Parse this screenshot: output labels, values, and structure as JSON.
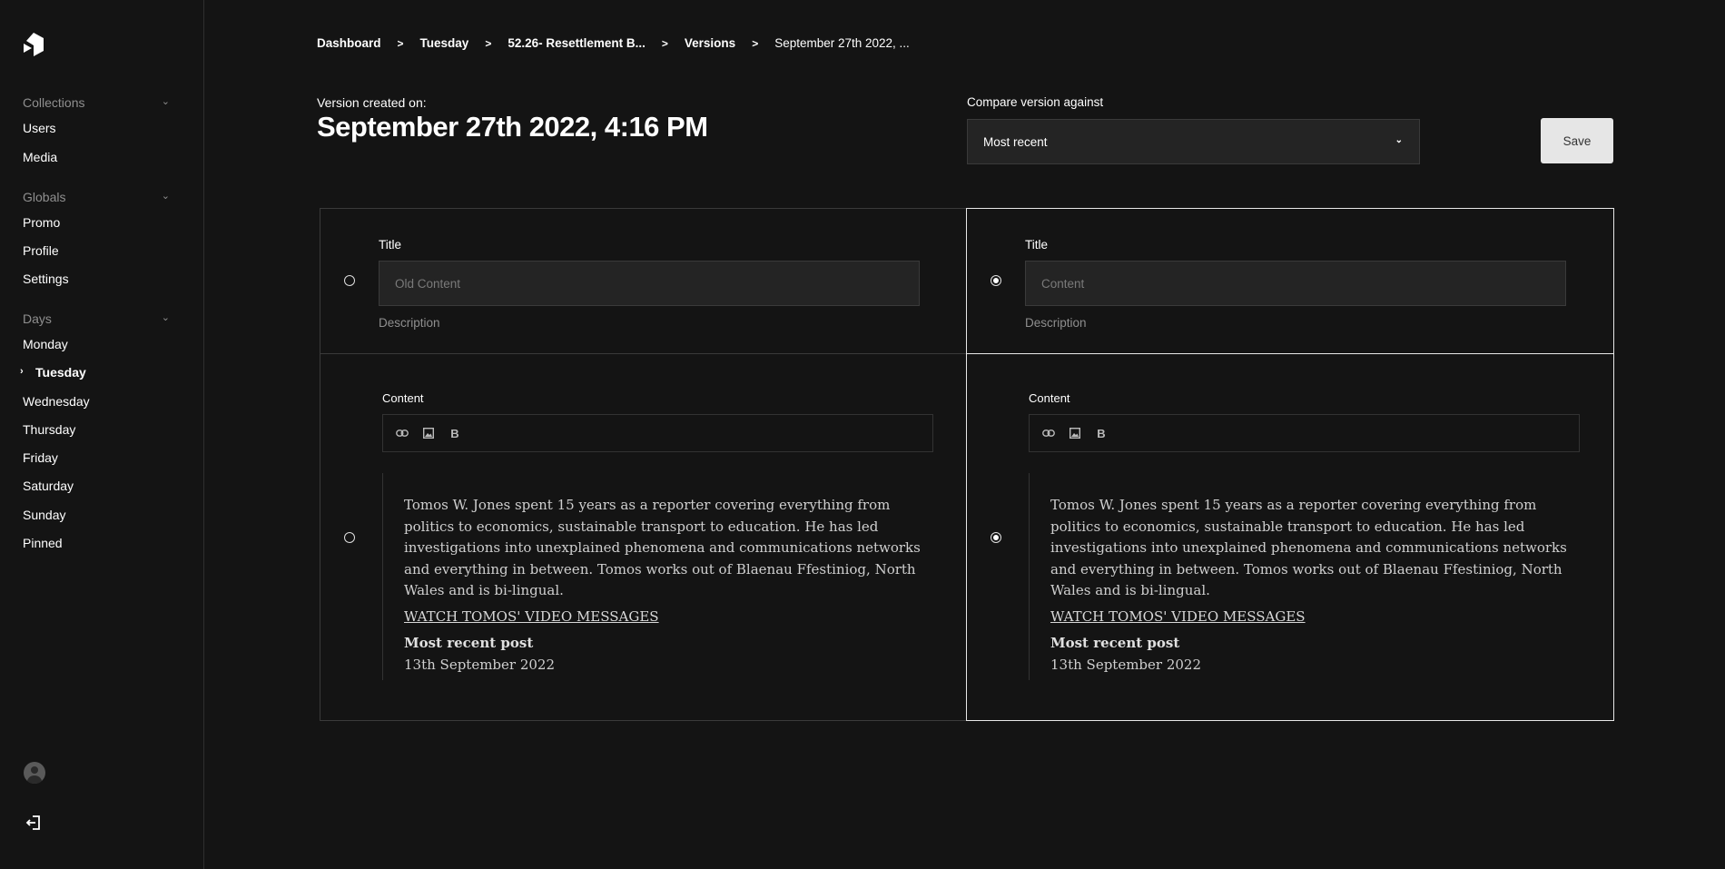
{
  "sidebar": {
    "groups": [
      {
        "label": "Collections",
        "items": [
          "Users",
          "Media"
        ]
      },
      {
        "label": "Globals",
        "items": [
          "Promo",
          "Profile",
          "Settings"
        ]
      },
      {
        "label": "Days",
        "items": [
          "Monday",
          "Tuesday",
          "Wednesday",
          "Thursday",
          "Friday",
          "Saturday",
          "Sunday",
          "Pinned"
        ]
      }
    ],
    "active_item": "Tuesday"
  },
  "breadcrumb": {
    "items": [
      "Dashboard",
      "Tuesday",
      "52.26- Resettlement B...",
      "Versions"
    ],
    "current": "September 27th 2022, ..."
  },
  "header": {
    "created_label": "Version created on:",
    "created_date": "September 27th 2022, 4:16 PM",
    "compare_label": "Compare version against",
    "compare_value": "Most recent",
    "save_label": "Save"
  },
  "left": {
    "title_label": "Title",
    "title_placeholder": "Old Content",
    "description_label": "Description",
    "content_label": "Content",
    "body": "Tomos W. Jones spent 15 years as a reporter covering everything from politics to economics, sustainable transport to education. He has led investigations into unexplained phenomena and communications networks and everything in between. Tomos works out of Blaenau Ffestiniog, North Wales and is bi-lingual.",
    "link": "WATCH TOMOS' VIDEO MESSAGES",
    "recent_heading": "Most recent post",
    "recent_date": "13th September 2022"
  },
  "right": {
    "title_label": "Title",
    "title_placeholder": "Content",
    "description_label": "Description",
    "content_label": "Content",
    "body": "Tomos W. Jones spent 15 years as a reporter covering everything from politics to economics, sustainable transport to education. He has led investigations into unexplained phenomena and communications networks and everything in between. Tomos works out of Blaenau Ffestiniog, North Wales and is bi-lingual.",
    "link": "WATCH TOMOS' VIDEO MESSAGES",
    "recent_heading": "Most recent post",
    "recent_date": "13th September 2022"
  },
  "selection": {
    "left_selected": false,
    "right_selected": true
  },
  "icons": [
    "logo-icon",
    "chevron-down-icon",
    "chevron-right-icon",
    "avatar-icon",
    "logout-icon",
    "link-icon",
    "image-icon",
    "bold-icon"
  ]
}
